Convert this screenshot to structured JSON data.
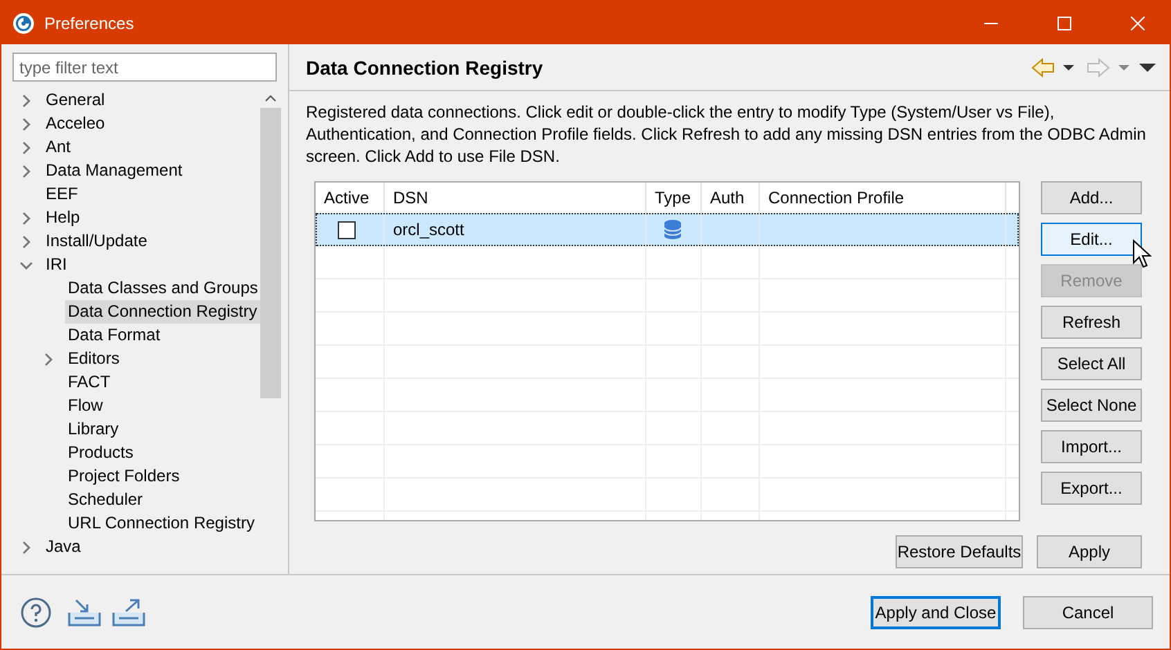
{
  "window": {
    "title": "Preferences"
  },
  "filter": {
    "placeholder": "type filter text"
  },
  "tree": [
    {
      "label": "General",
      "kind": "group",
      "expanded": false,
      "selected": false
    },
    {
      "label": "Acceleo",
      "kind": "group",
      "expanded": false,
      "selected": false
    },
    {
      "label": "Ant",
      "kind": "group",
      "expanded": false,
      "selected": false
    },
    {
      "label": "Data Management",
      "kind": "group",
      "expanded": false,
      "selected": false
    },
    {
      "label": "EEF",
      "kind": "leaf",
      "selected": false
    },
    {
      "label": "Help",
      "kind": "group",
      "expanded": false,
      "selected": false
    },
    {
      "label": "Install/Update",
      "kind": "group",
      "expanded": false,
      "selected": false
    },
    {
      "label": "IRI",
      "kind": "group",
      "expanded": true,
      "selected": false,
      "children": [
        {
          "label": "Data Classes and Groups",
          "kind": "leaf",
          "selected": false
        },
        {
          "label": "Data Connection Registry",
          "kind": "leaf",
          "selected": true
        },
        {
          "label": "Data Format",
          "kind": "leaf",
          "selected": false
        },
        {
          "label": "Editors",
          "kind": "group",
          "expanded": false,
          "selected": false
        },
        {
          "label": "FACT",
          "kind": "leaf",
          "selected": false
        },
        {
          "label": "Flow",
          "kind": "leaf",
          "selected": false
        },
        {
          "label": "Library",
          "kind": "leaf",
          "selected": false
        },
        {
          "label": "Products",
          "kind": "leaf",
          "selected": false
        },
        {
          "label": "Project Folders",
          "kind": "leaf",
          "selected": false
        },
        {
          "label": "Scheduler",
          "kind": "leaf",
          "selected": false
        },
        {
          "label": "URL Connection Registry",
          "kind": "leaf",
          "selected": false
        }
      ]
    },
    {
      "label": "Java",
      "kind": "group",
      "expanded": false,
      "selected": false
    }
  ],
  "page": {
    "title": "Data Connection Registry",
    "back_disabled": false,
    "forward_disabled": true,
    "description": "Registered data connections. Click edit or double-click the entry to modify Type (System/User vs File), Authentication, and Connection Profile fields. Click Refresh to add any missing DSN entries from the ODBC Admin screen. Click Add to use File DSN."
  },
  "table": {
    "columns": [
      "Active",
      "DSN",
      "Type",
      "Auth",
      "Connection Profile"
    ],
    "rows": [
      {
        "active": false,
        "dsn": "orcl_scott",
        "selected": true
      }
    ]
  },
  "side_buttons": [
    {
      "label": "Add...",
      "disabled": false,
      "hovered": false
    },
    {
      "label": "Edit...",
      "disabled": false,
      "hovered": true
    },
    {
      "label": "Remove",
      "disabled": true,
      "hovered": false
    },
    {
      "label": "Refresh",
      "disabled": false,
      "hovered": false
    },
    {
      "label": "Select All",
      "disabled": false,
      "hovered": false
    },
    {
      "label": "Select None",
      "disabled": false,
      "hovered": false
    },
    {
      "label": "Import...",
      "disabled": false,
      "hovered": false
    },
    {
      "label": "Export...",
      "disabled": false,
      "hovered": false
    }
  ],
  "page_buttons": [
    "Restore Defaults",
    "Apply"
  ],
  "footer_buttons": [
    {
      "label": "Apply and Close",
      "default": true
    },
    {
      "label": "Cancel",
      "default": false
    }
  ]
}
